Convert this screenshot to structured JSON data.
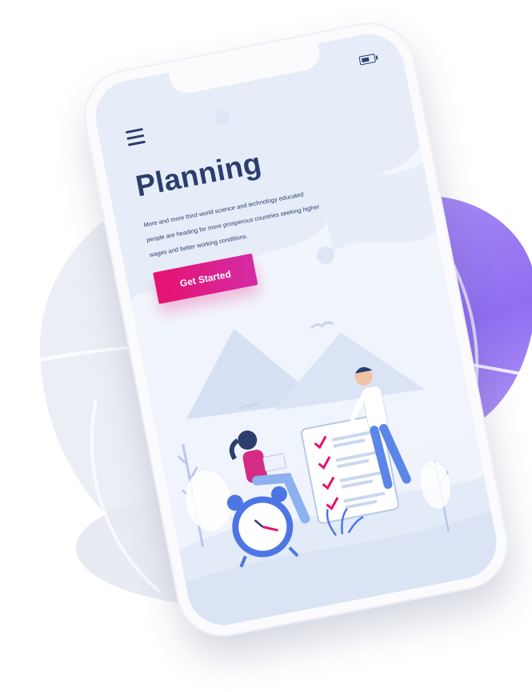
{
  "status_bar": {
    "battery_icon": "battery-icon"
  },
  "header": {
    "menu_icon": "hamburger-menu-icon"
  },
  "hero": {
    "title": "Planning",
    "description": "More and more third world science and technology educated people are heading for more prosperous countries seeking higher wages and better working conditions.",
    "cta_label": "Get Started"
  },
  "colors": {
    "title_navy": "#2c3e6e",
    "cta_pink": "#e6116f",
    "cta_magenta": "#d42ca4",
    "accent_purple": "#9b7cf3",
    "background_grey": "#eceef5"
  }
}
